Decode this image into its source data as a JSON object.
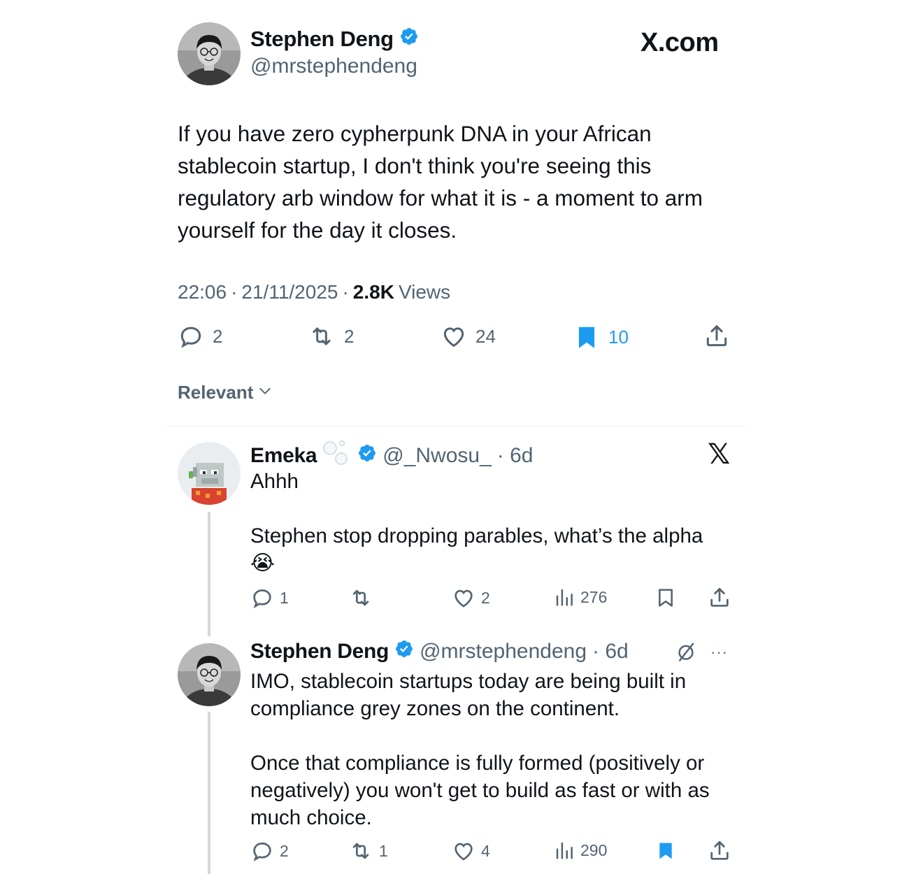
{
  "main_tweet": {
    "author_name": "Stephen Deng",
    "author_handle": "@mrstephendeng",
    "brand": "X.com",
    "text": "If you have zero cypherpunk DNA in your African stablecoin startup, I don't think you're seeing this regulatory arb window for what it is - a moment to arm yourself for the day it closes.",
    "time": "22:06",
    "date": "21/11/2025",
    "views_count": "2.8K",
    "views_label": "Views",
    "separator": "·",
    "replies": "2",
    "reposts": "2",
    "likes": "24",
    "bookmarks": "10",
    "accent_color": "#1d9bf0"
  },
  "sort": {
    "label": "Relevant"
  },
  "replies": [
    {
      "author_name": "Emeka",
      "author_handle": "@_Nwosu_",
      "age": "· 6d",
      "text_line1": "Ahhh",
      "text_line2": "Stephen stop dropping parables, what’s the alpha",
      "emoji": "😭",
      "replies": "1",
      "reposts": "",
      "likes": "2",
      "views": "276",
      "bookmarked": false
    },
    {
      "author_name": "Stephen Deng",
      "author_handle": "@mrstephendeng",
      "age": "· 6d",
      "text_para1": "IMO, stablecoin startups today are being built in compliance grey zones on the continent.",
      "text_para2": "Once that compliance is fully formed (positively or negatively) you won't get to build as fast or with as much choice.",
      "replies": "2",
      "reposts": "1",
      "likes": "4",
      "views": "290",
      "bookmarked": true,
      "more": "···"
    }
  ]
}
